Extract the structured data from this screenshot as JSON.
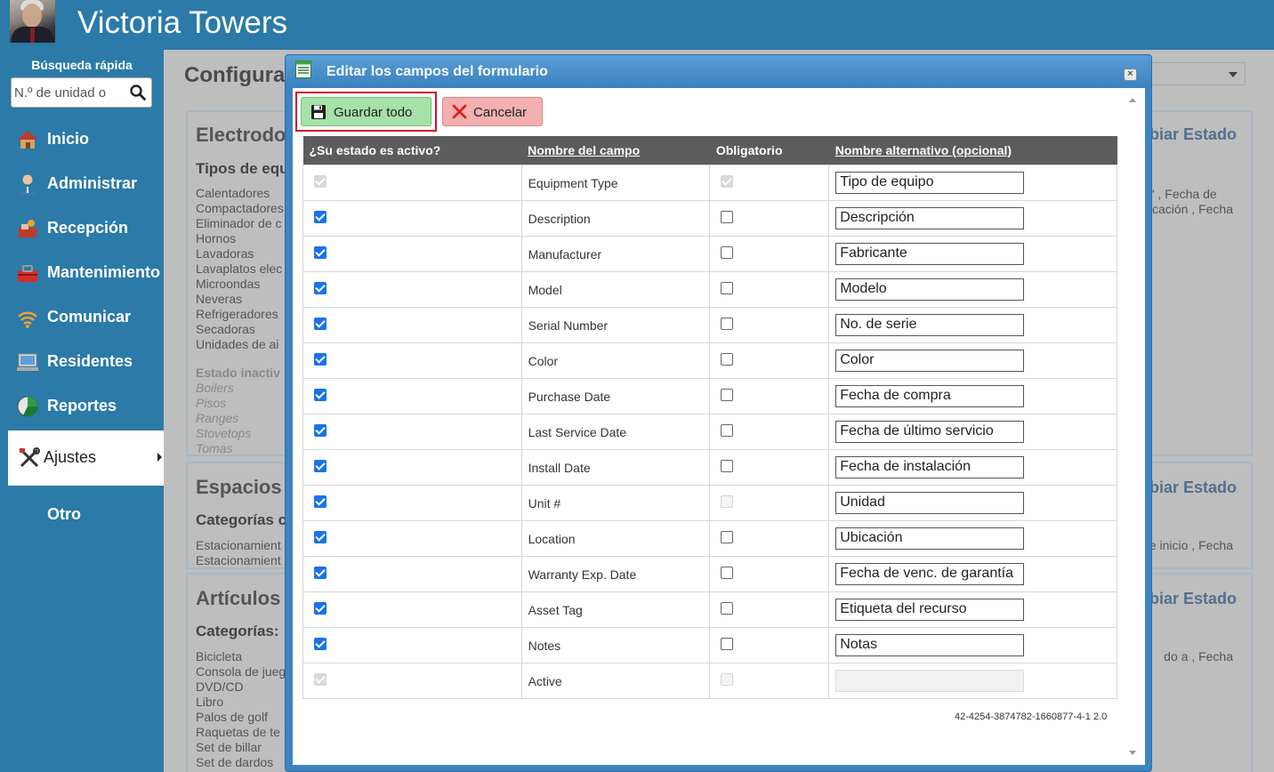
{
  "app": {
    "title": "Victoria Towers"
  },
  "sidebar": {
    "quick_search_label": "Búsqueda rápida",
    "quick_search_placeholder": "N.º de unidad o",
    "items": [
      {
        "label": "Inicio",
        "icon": "house-icon"
      },
      {
        "label": "Administrar",
        "icon": "admin-user-icon"
      },
      {
        "label": "Recepción",
        "icon": "reception-icon"
      },
      {
        "label": "Mantenimiento",
        "icon": "toolbox-icon"
      },
      {
        "label": "Comunicar",
        "icon": "wifi-icon"
      },
      {
        "label": "Residentes",
        "icon": "residents-icon"
      },
      {
        "label": "Reportes",
        "icon": "pie-chart-icon"
      },
      {
        "label": "Ajustes",
        "icon": "tools-icon",
        "active": true
      },
      {
        "label": "Otro"
      }
    ]
  },
  "background": {
    "page_title": "Configurac",
    "sections": [
      {
        "title": "Electrodo",
        "subtitle": "Tipos de equ",
        "status_link": "biar Estado",
        "right_text": [
          "' , Fecha de",
          "cación , Fecha"
        ],
        "items": [
          "Calentadores",
          "Compactadores",
          "Eliminador de c",
          "Hornos",
          "Lavadoras",
          "Lavaplatos elec",
          "Microondas",
          "Neveras",
          "Refrigeradores",
          "Secadoras",
          "Unidades de ai"
        ],
        "inactive_title": "Estado inactiv",
        "inactive_items": [
          "Boilers",
          "Pisos",
          "Ranges",
          "Stovetops",
          "Tomas"
        ]
      },
      {
        "title": "Espacios",
        "subtitle": "Categorías c",
        "status_link": "biar Estado",
        "right_text": [
          "e inicio , Fecha"
        ],
        "items": [
          "Estacionamient",
          "Estacionamient"
        ]
      },
      {
        "title": "Artículos",
        "subtitle": "Categorías:",
        "status_link": "biar Estado",
        "right_text": [
          "do a , Fecha"
        ],
        "items": [
          "Bicicleta",
          "Consola de jueg",
          "DVD/CD",
          "Libro",
          "Palos de golf",
          "Raquetas de te",
          "Set de billar",
          "Set de dardos"
        ]
      }
    ]
  },
  "modal": {
    "title": "Editar los campos del formulario",
    "close_label": "×",
    "save_label": "Guardar todo",
    "cancel_label": "Cancelar",
    "columns": [
      "¿Su estado es activo?",
      "Nombre del campo",
      "Obligatorio",
      "Nombre alternativo (opcional)"
    ],
    "rows": [
      {
        "active": "disabled-checked",
        "field": "Equipment Type",
        "required": "disabled-checked",
        "alt": "Tipo de equipo"
      },
      {
        "active": "checked",
        "field": "Description",
        "required": "unchecked",
        "alt": "Descripción"
      },
      {
        "active": "checked",
        "field": "Manufacturer",
        "required": "unchecked",
        "alt": "Fabricante"
      },
      {
        "active": "checked",
        "field": "Model",
        "required": "unchecked",
        "alt": "Modelo"
      },
      {
        "active": "checked",
        "field": "Serial Number",
        "required": "unchecked",
        "alt": "No. de serie"
      },
      {
        "active": "checked",
        "field": "Color",
        "required": "unchecked",
        "alt": "Color"
      },
      {
        "active": "checked",
        "field": "Purchase Date",
        "required": "unchecked",
        "alt": "Fecha de compra"
      },
      {
        "active": "checked",
        "field": "Last Service Date",
        "required": "unchecked",
        "alt": "Fecha de último servicio"
      },
      {
        "active": "checked",
        "field": "Install Date",
        "required": "unchecked",
        "alt": "Fecha de instalación"
      },
      {
        "active": "checked",
        "field": "Unit #",
        "required": "disabled",
        "alt": "Unidad"
      },
      {
        "active": "checked",
        "field": "Location",
        "required": "unchecked",
        "alt": "Ubicación"
      },
      {
        "active": "checked",
        "field": "Warranty Exp. Date",
        "required": "unchecked",
        "alt": "Fecha de venc. de garantía"
      },
      {
        "active": "checked",
        "field": "Asset Tag",
        "required": "unchecked",
        "alt": "Etiqueta del recurso"
      },
      {
        "active": "checked",
        "field": "Notes",
        "required": "unchecked",
        "alt": "Notas"
      },
      {
        "active": "disabled-checked",
        "field": "Active",
        "required": "disabled",
        "alt": "",
        "alt_disabled": true
      }
    ],
    "version": "42-4254-3874782-1660877-4-1 2.0"
  }
}
